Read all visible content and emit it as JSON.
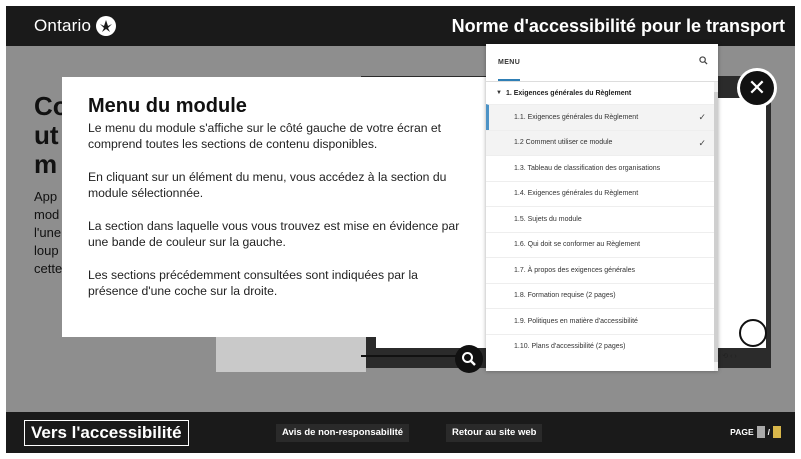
{
  "header": {
    "brand": "Ontario",
    "app_title": "Norme d'accessibilité pour le transport"
  },
  "background": {
    "heading_fragment": "Co ut m",
    "para_fragment": "App mod l'une loup cette",
    "controls_text": "‹ ⟲ ‹ ›"
  },
  "help_modal": {
    "title": "Menu du module",
    "paragraphs": [
      "Le menu du module s'affiche sur le côté gauche de votre écran et comprend toutes les sections de contenu disponibles.",
      "En cliquant sur un élément du menu, vous accédez à la section du module sélectionnée.",
      "La section dans laquelle vous vous trouvez est mise en évidence par une bande de couleur sur la gauche.",
      "Les sections précédemment consultées sont indiquées par la présence d'une coche sur la droite."
    ]
  },
  "menu": {
    "label": "MENU",
    "search_icon": "search-icon",
    "section": "1. Exigences générales du Règlement",
    "items": [
      {
        "label": "1.1. Exigences générales du Règlement",
        "state": "current",
        "checked": true
      },
      {
        "label": "1.2  Comment utiliser ce module",
        "state": "visited",
        "checked": true
      },
      {
        "label": "1.3. Tableau de classification des organisations",
        "state": "",
        "checked": false
      },
      {
        "label": "1.4. Exigences générales du Règlement",
        "state": "",
        "checked": false
      },
      {
        "label": "1.5. Sujets du module",
        "state": "",
        "checked": false
      },
      {
        "label": "1.6. Qui doit se conformer au Règlement",
        "state": "",
        "checked": false
      },
      {
        "label": "1.7. À propos des exigences générales",
        "state": "",
        "checked": false
      },
      {
        "label": "1.8. Formation requise (2 pages)",
        "state": "",
        "checked": false
      },
      {
        "label": "1.9. Politiques en matière d'accessibilité",
        "state": "",
        "checked": false
      },
      {
        "label": "1.10. Plans d'accessibilité (2 pages)",
        "state": "",
        "checked": false
      }
    ],
    "check_glyph": "✓",
    "accent_color": "#4d93c6"
  },
  "footer": {
    "brand": "Vers l'accessibilité",
    "disclaimer": "Avis de non-responsabilité",
    "back": "Retour au site web",
    "page_label": "PAGE",
    "page_current": "",
    "page_separator": "/",
    "page_total": ""
  }
}
